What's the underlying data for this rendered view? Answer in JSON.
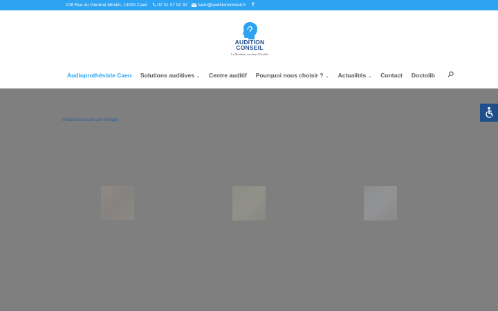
{
  "topbar": {
    "address": "108 Rue du Général Moulin, 14000 Caen",
    "phone": "02 31 07 92 32",
    "email": "caen@auditionconseil.fr",
    "icons": [
      "phone-icon",
      "envelope-icon",
      "facebook-icon"
    ]
  },
  "logo": {
    "line1": "AUDITION",
    "line2": "CONSEIL",
    "tagline": "Le Bonheur est dans l'Oreille"
  },
  "nav": {
    "items": [
      {
        "label": "Audioprothésiste Caen",
        "active": true
      },
      {
        "label": "Solutions auditives",
        "has_dropdown": true
      },
      {
        "label": "Centre auditif"
      },
      {
        "label": "Pourquoi nous choisir ?",
        "has_dropdown": true
      },
      {
        "label": "Actualités",
        "has_dropdown": true
      },
      {
        "label": "Contact"
      },
      {
        "label": "Doctolib"
      }
    ],
    "search_icon": "search-icon"
  },
  "main": {
    "hint": "Passez la souris sur l'image"
  },
  "accessibility_icon": "accessibility-icon",
  "colors": {
    "topbar": "#2ea3f2",
    "accent": "#2ea3f2",
    "brand": "#1f4e8c",
    "overlay": "#7f7f7f"
  }
}
